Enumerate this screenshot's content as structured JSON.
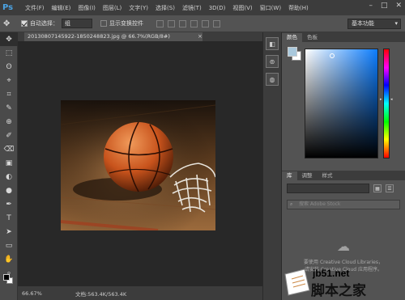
{
  "app": {
    "logo": "Ps"
  },
  "menubar": {
    "items": [
      "文件(F)",
      "编辑(E)",
      "图像(I)",
      "图层(L)",
      "文字(Y)",
      "选择(S)",
      "滤镜(T)",
      "3D(D)",
      "视图(V)",
      "窗口(W)",
      "帮助(H)"
    ],
    "window_controls": [
      "–",
      "□",
      "✕"
    ]
  },
  "options_bar": {
    "auto_select_label": "自动选择：",
    "auto_select_value": "组",
    "transform_label": "显示变换控件",
    "workspace": "基本功能"
  },
  "document": {
    "tab_title": "20130807145922-1850248823.jpg @ 66.7%(RGB/8#)",
    "close_glyph": "×",
    "zoom": "66.67%",
    "doc_info": "文档:563.4K/563.4K"
  },
  "color_panel": {
    "tabs": [
      "颜色",
      "色板"
    ],
    "fg_color": "#a9c8dc",
    "bg_color": "#ffffff",
    "hue_marker_left": "▸",
    "hue_marker_right": "◂"
  },
  "library_panel": {
    "tabs": [
      "库",
      "调整",
      "样式"
    ],
    "search_placeholder": "搜索 Adobe Stock",
    "message_line1": "要使用 Creative Cloud Libraries，",
    "message_line2": "请安装 Creative Cloud 应用程序。",
    "grid_glyph": "▦",
    "list_glyph": "☰",
    "cc_icon": "cloud-off-icon"
  },
  "tools": [
    "✥",
    "⬚",
    "ʘ",
    "⌖",
    "⌗",
    "✎",
    "⊕",
    "✐",
    "⌫",
    "▣",
    "◐",
    "●",
    "✒",
    "T",
    "➤",
    "▭",
    "✋",
    "⌕"
  ],
  "dock_icons": [
    "◧",
    "⊚",
    "◍"
  ],
  "watermark": {
    "url": "jb51.net",
    "title": "脚本之家"
  }
}
